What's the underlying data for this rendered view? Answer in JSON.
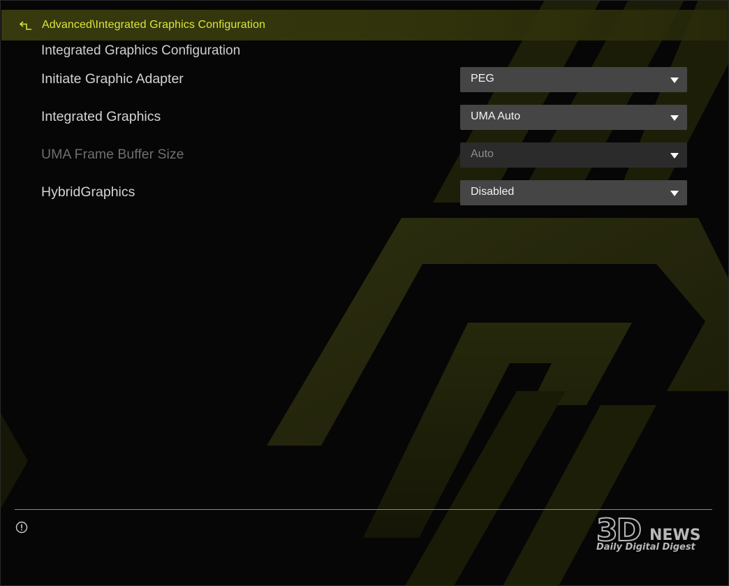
{
  "breadcrumb": {
    "path": "Advanced\\Integrated Graphics Configuration"
  },
  "page": {
    "section_title": "Integrated Graphics Configuration"
  },
  "settings": [
    {
      "label": "Initiate Graphic Adapter",
      "value": "PEG",
      "enabled": true
    },
    {
      "label": "Integrated Graphics",
      "value": "UMA Auto",
      "enabled": true
    },
    {
      "label": "UMA Frame Buffer Size",
      "value": "Auto",
      "enabled": false
    },
    {
      "label": "HybridGraphics",
      "value": "Disabled",
      "enabled": true
    }
  ],
  "watermark": {
    "logo_main": "3D",
    "logo_sub": "NEWS",
    "tagline": "Daily Digital Digest"
  },
  "icons": {
    "back": "back-arrow-icon",
    "info": "info-icon",
    "caret": "caret-down-icon"
  },
  "colors": {
    "accent": "#d8e83a",
    "breadcrumb_bar": "#3a3c0e",
    "dropdown_bg": "#454545",
    "dropdown_disabled_bg": "#2b2b2b",
    "background": "#060606",
    "label_text": "#d4d4d4",
    "disabled_text": "#6e6e6e"
  }
}
